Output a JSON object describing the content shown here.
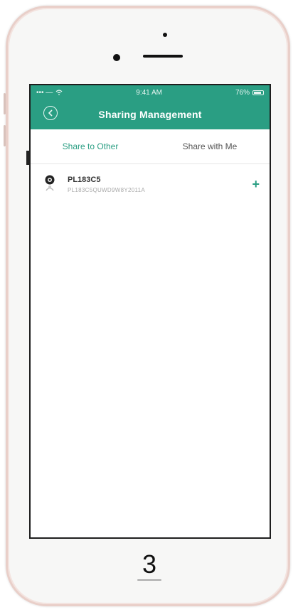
{
  "status_bar": {
    "carrier": "••• —",
    "time": "9:41 AM",
    "battery": "76%"
  },
  "nav": {
    "title": "Sharing Management",
    "back_icon": "back-chevron-icon"
  },
  "tabs": [
    {
      "label": "Share to Other",
      "active": true
    },
    {
      "label": "Share with Me",
      "active": false
    }
  ],
  "devices": [
    {
      "name": "PL183C5",
      "id": "PL183C5QUWD9W8Y2011A",
      "icon": "camera-icon",
      "action_icon": "plus-icon",
      "action": "+"
    }
  ],
  "home_button": {
    "label": "3"
  },
  "colors": {
    "accent": "#2a9e83",
    "phone_frame": "#e9cfc9"
  }
}
